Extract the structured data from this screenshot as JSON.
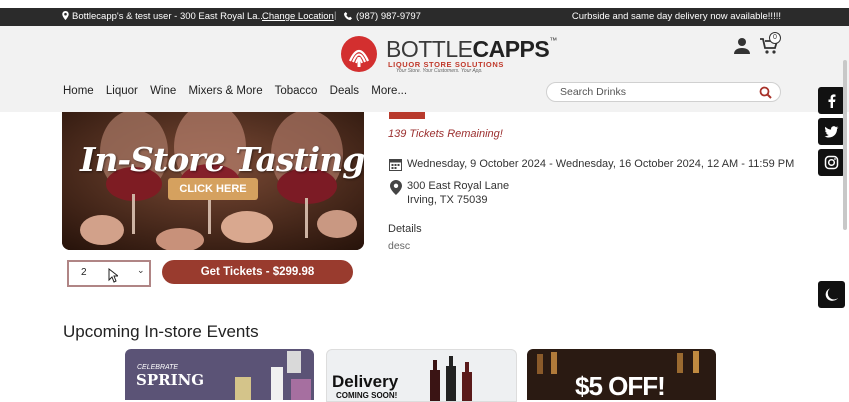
{
  "topbar": {
    "location": "Bottlecapp's & test user - 300 East Royal La...",
    "change_location": "Change Location",
    "phone": "(987) 987-9797",
    "promo": "Curbside and same day delivery now available!!!!!"
  },
  "header": {
    "logo_text_light": "BOTTLE",
    "logo_text_bold": "CAPPS",
    "logo_tm": "™",
    "logo_sub": "LIQUOR STORE SOLUTIONS",
    "logo_tagline": "Your Store. Your Customers. Your App.",
    "cart_count": "0"
  },
  "nav": {
    "items": [
      "Home",
      "Liquor",
      "Wine",
      "Mixers & More",
      "Tobacco",
      "Deals",
      "More..."
    ]
  },
  "search": {
    "placeholder": "Search Drinks"
  },
  "event": {
    "banner_title": "In-Store Tastings",
    "banner_button": "CLICK HERE",
    "quantity": "2",
    "get_tickets": "Get Tickets - $299.98",
    "tickets_remaining": "139 Tickets Remaining!",
    "dates": "Wednesday, 9 October 2024 - Wednesday, 16 October 2024, 12 AM - 11:59 PM",
    "address_line1": "300 East Royal Lane",
    "address_line2": "Irving, TX 75039",
    "details_label": "Details",
    "details_text": "desc"
  },
  "upcoming": {
    "heading": "Upcoming In-store Events",
    "cards": [
      {
        "line1": "CELEBRATE",
        "line2": "SPRING"
      },
      {
        "line1": "Delivery",
        "line2": "COMING SOON!"
      },
      {
        "line1": "$5 OFF!"
      }
    ]
  },
  "icons": {
    "social": [
      "facebook-icon",
      "twitter-icon",
      "instagram-icon"
    ],
    "theme": "moon-icon"
  },
  "colors": {
    "brand_red": "#993b2e",
    "topbar": "#2b2b2b",
    "accent_gold": "#d5a15f"
  }
}
